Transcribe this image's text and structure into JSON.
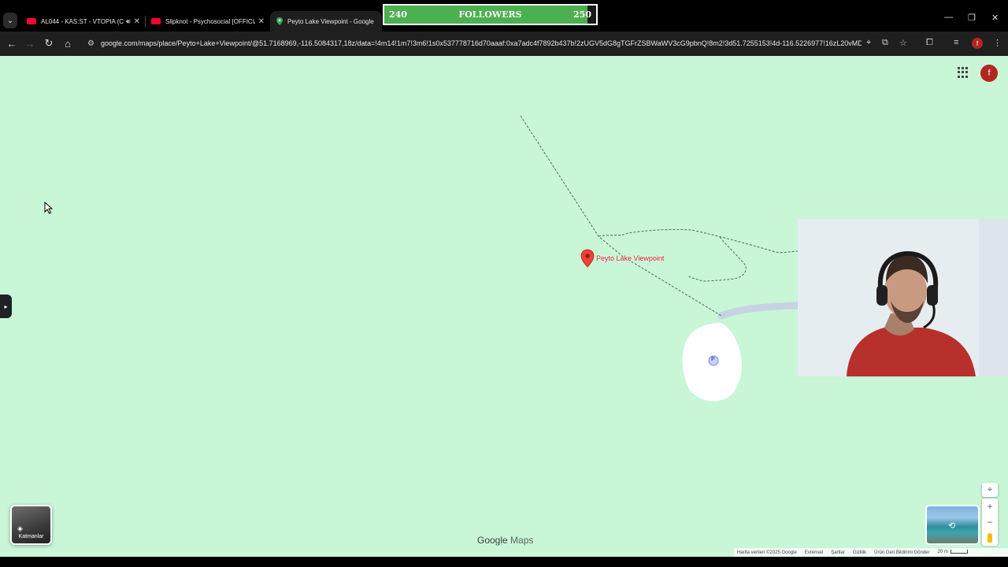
{
  "browser": {
    "tabs": [
      {
        "title": "AL044 - KAS:ST - VTOPIA (C",
        "favicon": "youtube-icon",
        "audio": true
      },
      {
        "title": "Slipknot - Psychosocial [OFFICIAL",
        "favicon": "youtube-icon",
        "audio": false
      },
      {
        "title": "Peyto Lake Viewpoint - Google",
        "favicon": "maps-pin-icon",
        "active": true
      }
    ],
    "url": "google.com/maps/place/Peyto+Lake+Viewpoint/@51.7168969,-116.5084317,18z/data=!4m14!1m7!3m6!1s0x537778716d70aaaf:0xa7adc4f7892b437b!2zUGV5dG8gTGFrZSBWaWV3cG9pbnQ!8m2!3d51.7255153!4d-116.5226977!16zL20vMDR6NXd...",
    "profile_initial": "f"
  },
  "overlay": {
    "followers_label": "FOLLOWERS",
    "followers_current": "240",
    "followers_goal": "250",
    "followers_progress": 0.96
  },
  "map": {
    "place_label": "Peyto Lake Viewpoint",
    "parking_label": "P",
    "account_initial": "f",
    "layers_label": "Katmanlar",
    "logo_google": "Google",
    "logo_maps": "Maps",
    "footer": {
      "data": "Harita verileri ©2025 Google",
      "global": "Evrensel",
      "terms": "Şartlar",
      "privacy": "Gizlilik",
      "feedback": "Ürün Geri Bildirimi Gönder",
      "scale": "20 m"
    }
  },
  "colors": {
    "map_bg": "#c8f6d6",
    "pin": "#ea4335",
    "followers_bar": "#4caf50",
    "toolbar": "#1f1f1f"
  }
}
